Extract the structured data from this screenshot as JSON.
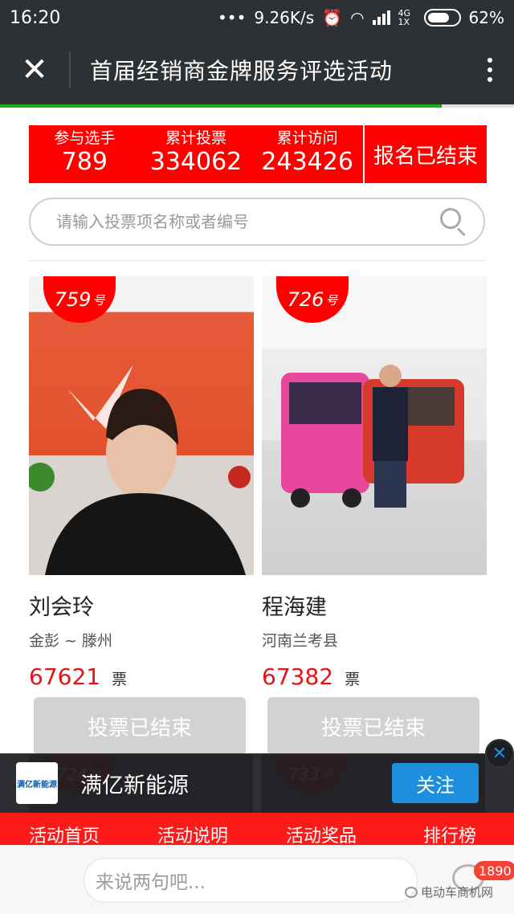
{
  "status_bar": {
    "time": "16:20",
    "dots": "•••",
    "speed": "9.26K/s",
    "network": "4G 1X",
    "battery": "62%"
  },
  "nav": {
    "title": "首届经销商金牌服务评选活动"
  },
  "page_load_progress_pct": 86,
  "stats": [
    {
      "label": "参与选手",
      "value": "789"
    },
    {
      "label": "累计投票",
      "value": "334062"
    },
    {
      "label": "累计访问",
      "value": "243426"
    }
  ],
  "register_status": "报名已结束",
  "search": {
    "placeholder": "请输入投票项名称或者编号"
  },
  "cards": [
    {
      "badge_num": "759",
      "badge_suffix": "号",
      "name": "刘会玲",
      "dealer": "金彭 ~ 滕州",
      "votes": "67621",
      "unit": "票",
      "button": "投票已结束"
    },
    {
      "badge_num": "726",
      "badge_suffix": "号",
      "name": "程海建",
      "dealer": "河南兰考县",
      "votes": "67382",
      "unit": "票",
      "button": "投票已结束"
    }
  ],
  "bottom_badges": [
    {
      "num": "724",
      "suffix": "号"
    },
    {
      "num": "733",
      "suffix": "号"
    }
  ],
  "follow": {
    "name": "满亿新能源",
    "logo_text": "满亿新能源",
    "button": "关注"
  },
  "tabs": [
    "活动首页",
    "活动说明",
    "活动奖品",
    "排行榜"
  ],
  "comment": {
    "placeholder": "来说两句吧...",
    "count": "1890"
  },
  "watermark": "电动车商机网",
  "colors": {
    "accent_red": "#ff0000",
    "vote_red": "#e4131b",
    "follow_blue": "#1e8fde",
    "dark": "#2e3134"
  }
}
